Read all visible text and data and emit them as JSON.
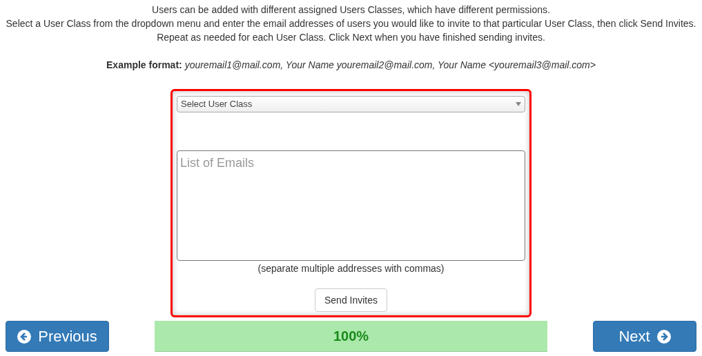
{
  "intro": [
    "Users can be added with different assigned Users Classes, which have different permissions.",
    "Select a User Class from the dropdown menu and enter the email addresses of users you would like to invite to that particular User Class, then click Send Invites.",
    "Repeat as needed for each User Class. Click Next when you have finished sending invites."
  ],
  "example": "**Example format:** *youremail1@mail.com, Your Name youremail2@mail.com, Your Name <youremail3@mail.com>*",
  "form": {
    "select": {
      "value": "Select User Class"
    },
    "emails": {
      "placeholder": "List of Emails"
    },
    "hint": "(separate multiple addresses with commas)",
    "send_button": "Send Invites"
  },
  "nav": {
    "previous": "Previous",
    "next": "Next"
  },
  "progress": {
    "level": 1,
    "reading": "100%"
  }
}
